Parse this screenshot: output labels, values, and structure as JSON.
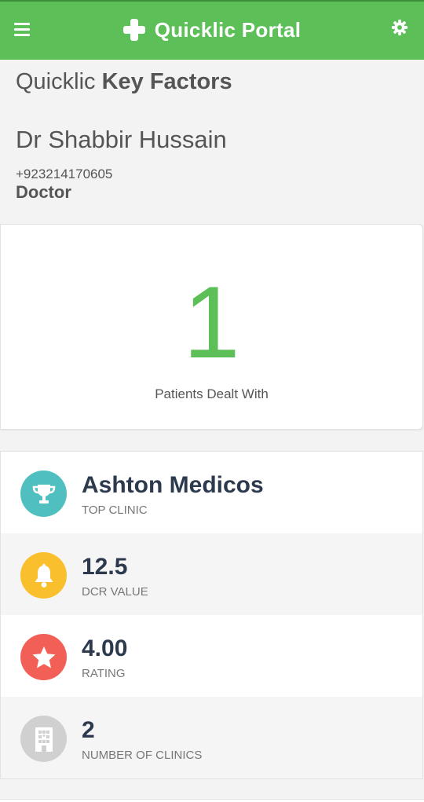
{
  "header": {
    "title": "Quicklic Portal",
    "icons": {
      "menu": "hamburger-icon",
      "brand": "plus-cross-icon",
      "settings": "gear-icon"
    }
  },
  "heading": {
    "prefix": "Quicklic",
    "bold": "Key Factors"
  },
  "doctor": {
    "name": "Dr Shabbir Hussain",
    "phone": "+923214170605",
    "role": "Doctor"
  },
  "stats": {
    "patients_count": "1",
    "patients_label": "Patients Dealt With"
  },
  "factors": [
    {
      "value": "Ashton Medicos",
      "caption": "TOP CLINIC",
      "icon": "trophy-icon",
      "color": "#4fbfc0"
    },
    {
      "value": "12.5",
      "caption": "DCR VALUE",
      "icon": "bell-icon",
      "color": "#f9bf2d"
    },
    {
      "value": "4.00",
      "caption": "RATING",
      "icon": "star-icon",
      "color": "#f25f57"
    },
    {
      "value": "2",
      "caption": "NUMBER OF CLINICS",
      "icon": "building-icon",
      "color": "#d0d0d0"
    }
  ],
  "colors": {
    "accent": "#5cbf58",
    "text": "#555555",
    "value_text": "#2d3a4e"
  }
}
